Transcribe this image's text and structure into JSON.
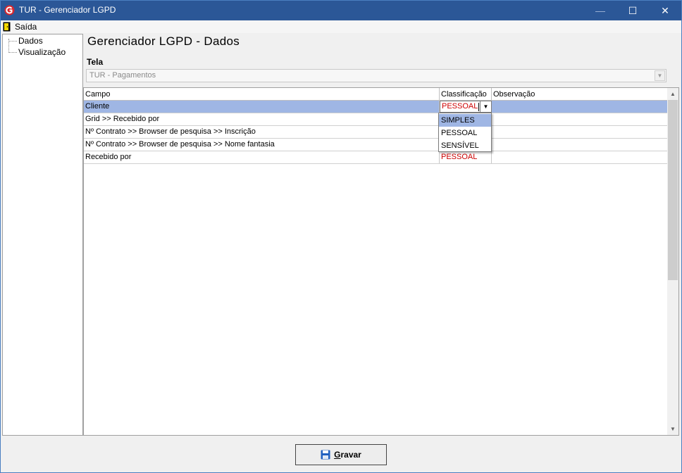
{
  "window": {
    "title": "TUR - Gerenciador LGPD",
    "minimize": "—",
    "maximize": "☐",
    "close": "✕"
  },
  "menu": {
    "exit_label": "Saída"
  },
  "tree": {
    "items": [
      "Dados",
      "Visualização"
    ]
  },
  "page": {
    "heading": "Gerenciador LGPD - Dados"
  },
  "tela": {
    "label": "Tela",
    "selected": "TUR - Pagamentos"
  },
  "grid": {
    "columns": [
      "Campo",
      "Classificação",
      "Observação"
    ],
    "rows": [
      {
        "campo": "Cliente",
        "classificacao": "PESSOAL",
        "observacao": ""
      },
      {
        "campo": "Grid >> Recebido por",
        "classificacao": "",
        "observacao": ""
      },
      {
        "campo": "Nº Contrato >> Browser de pesquisa >> Inscrição",
        "classificacao": "",
        "observacao": ""
      },
      {
        "campo": "Nº Contrato >> Browser de pesquisa >> Nome fantasia",
        "classificacao": "",
        "observacao": ""
      },
      {
        "campo": "Recebido por",
        "classificacao": "PESSOAL",
        "observacao": ""
      }
    ]
  },
  "dropdown": {
    "options": [
      "SIMPLES",
      "PESSOAL",
      "SENSÍVEL"
    ],
    "highlighted": "SIMPLES"
  },
  "footer": {
    "save_rest": "ravar",
    "save_mnemonic": "G"
  },
  "colors": {
    "titlebar": "#2b5797",
    "selection": "#9fb6e4",
    "classification_text": "#cc0000"
  },
  "icons": [
    "app-logo-icon",
    "exit-door-icon",
    "combo-arrow-icon",
    "scroll-up-icon",
    "scroll-down-icon",
    "floppy-disk-icon"
  ]
}
